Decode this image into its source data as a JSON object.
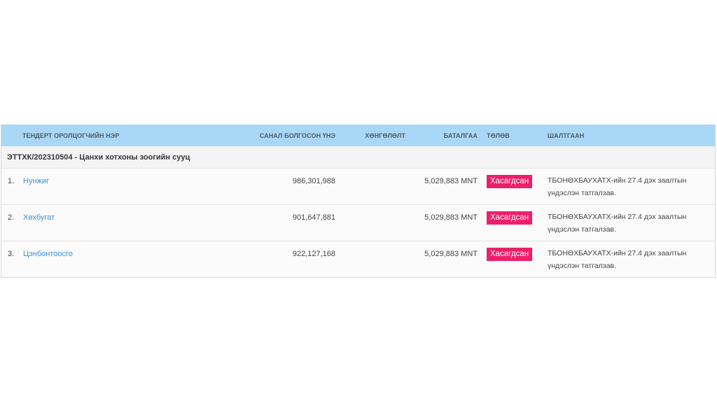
{
  "table": {
    "headers": {
      "name": "ТЕНДЕРТ ОРОЛЦОГЧИЙН НЭР",
      "price": "САНАЛ БОЛГОСОН ҮНЭ",
      "discount": "ХӨНГӨЛӨЛТ",
      "guarantee": "БАТАЛГАА",
      "status": "ТӨЛӨВ",
      "reason": "ШАЛТГААН"
    },
    "group_title": "ЭТТХК/202310504 - Цанхи хотхоны зоогийн сууц",
    "rows": [
      {
        "num": "1.",
        "name": "Нунжиг",
        "price": "986,301,988",
        "discount": "",
        "guarantee": "5,029,883 MNT",
        "status": "Хасагдсан",
        "reason_line1": "ТБОНӨХБАУХАТХ-ийн 27.4 дэх заалтын",
        "reason_line2": "үндэслэн татгалзав."
      },
      {
        "num": "2.",
        "name": "Хөхбугат",
        "price": "901,647,881",
        "discount": "",
        "guarantee": "5,029,883 MNT",
        "status": "Хасагдсан",
        "reason_line1": "ТБОНӨХБАУХАТХ-ийн 27.4 дэх заалтын",
        "reason_line2": "үндэслэн татгалзав."
      },
      {
        "num": "3.",
        "name": "Цэнбонтоосго",
        "price": "922,127,168",
        "discount": "",
        "guarantee": "5,029,883 MNT",
        "status": "Хасагдсан",
        "reason_line1": "ТБОНӨХБАУХАТХ-ийн 27.4 дэх заалтын",
        "reason_line2": "үндэслэн татгалзав."
      }
    ]
  },
  "colors": {
    "header_bg": "#a8d8f5",
    "link": "#3a8fd1",
    "status_rejected": "#ee1f6a"
  }
}
